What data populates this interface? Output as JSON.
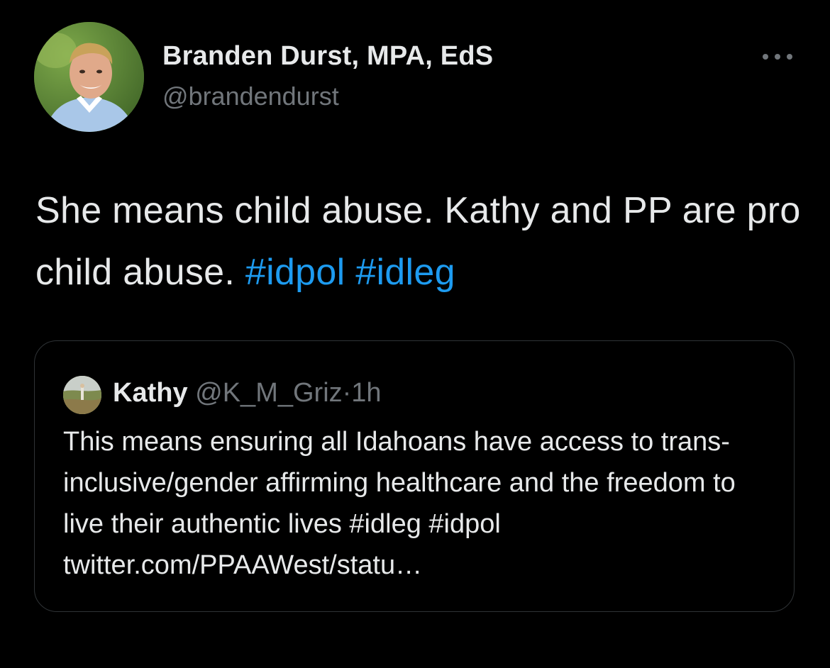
{
  "tweet": {
    "author_name": "Branden Durst, MPA, EdS",
    "author_handle": "@brandendurst",
    "text_plain": "She means child abuse. Kathy and PP are pro child abuse.",
    "hashtags": [
      "#idpol",
      "#idleg"
    ],
    "more_icon": "more-horizontal-icon",
    "avatar": "profile-photo"
  },
  "quote": {
    "name": "Kathy",
    "handle": "@K_M_Griz",
    "separator": "·",
    "time": "1h",
    "text": "This means ensuring all Idahoans have access to trans-inclusive/gender affirming healthcare and the freedom to live their authentic lives #idleg #idpol twitter.com/PPAAWest/statu…",
    "avatar": "profile-photo"
  },
  "colors": {
    "background": "#000000",
    "text_primary": "#e7e9ea",
    "text_secondary": "#71767b",
    "link": "#1d9bf0",
    "border": "#2f3336"
  }
}
